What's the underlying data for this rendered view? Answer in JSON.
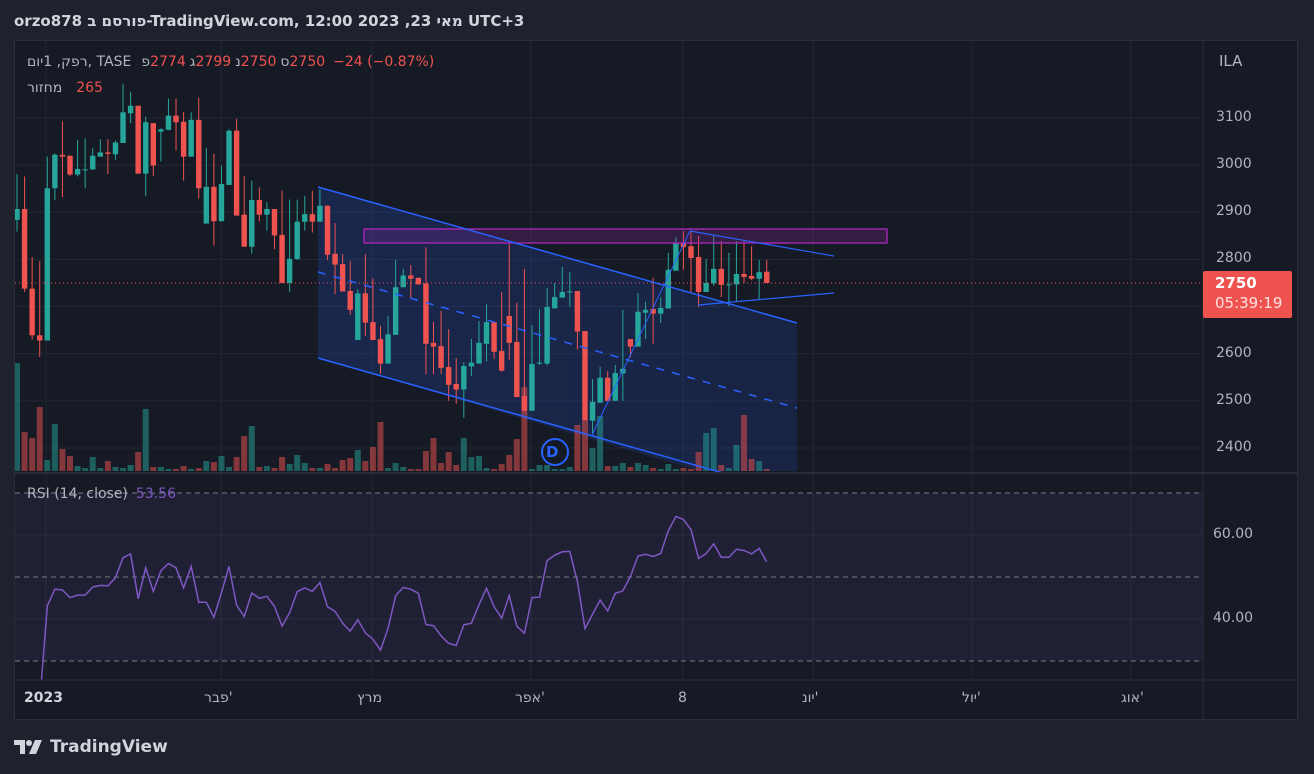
{
  "header": {
    "segments": [
      "orzo878 ",
      "פורסם ב",
      "-TradingView.com, 12:00 2023 ",
      ",23 ",
      "מאי",
      " UTC+3"
    ]
  },
  "legend": {
    "symbol": "רפק, 1יום, TASE",
    "open_label": "פ",
    "open": "2774",
    "high_label": "ג",
    "high": "2799",
    "low_label": "נ",
    "low": "2750",
    "close_label": "ס",
    "close": "2750",
    "change": "−24 (−0.87%)"
  },
  "volume_legend": {
    "label": "מחזור",
    "value": "265"
  },
  "rsi_legend": {
    "label": "RSI (14, close)",
    "value": "53.56"
  },
  "price_axis": {
    "currency": "ILA",
    "ticks": [
      "3100",
      "3000",
      "2900",
      "2800",
      "2600",
      "2500",
      "2400"
    ],
    "current_price": "2750",
    "countdown": "05:39:19"
  },
  "rsi_axis": {
    "ticks": [
      "60.00",
      "40.00"
    ]
  },
  "time_axis": {
    "ticks": [
      "2023",
      "פבר'",
      "מרץ",
      "אפר'",
      "8",
      "יונ'",
      "יול'",
      "אוג'"
    ]
  },
  "marker": {
    "label": "D"
  },
  "brand": {
    "name": "TradingView"
  },
  "colors": {
    "up": "#26a69a",
    "down": "#ef5350",
    "rsi": "#7e57c2",
    "drawing": "#2962ff",
    "zone": "#9c27b0"
  },
  "chart_data": {
    "type": "candlestick",
    "title": "רפק, 1יום, TASE",
    "ylabel": "ILA",
    "ylim": [
      2360,
      3190
    ],
    "y_ticks": [
      2400,
      2500,
      2600,
      2700,
      2800,
      2900,
      3000,
      3100
    ],
    "x_ticks": [
      "2023",
      "פבר'",
      "מרץ",
      "אפר'",
      "8",
      "יונ'",
      "יול'",
      "אוג'"
    ],
    "ohlc_fields": [
      "open",
      "high",
      "low",
      "close"
    ],
    "ohlc": [
      [
        2884,
        2981,
        2859,
        2907
      ],
      [
        2907,
        2976,
        2731,
        2738
      ],
      [
        2738,
        2805,
        2630,
        2639
      ],
      [
        2639,
        2796,
        2593,
        2628
      ],
      [
        2628,
        3018,
        2628,
        2951
      ],
      [
        2951,
        3025,
        2926,
        3022
      ],
      [
        3022,
        3093,
        2932,
        3018
      ],
      [
        3020,
        3020,
        2977,
        2980
      ],
      [
        2980,
        3054,
        2976,
        2992
      ],
      [
        2991,
        3057,
        2951,
        2991
      ],
      [
        2991,
        3036,
        2990,
        3020
      ],
      [
        3018,
        3055,
        3018,
        3027
      ],
      [
        3027,
        3055,
        2981,
        3024
      ],
      [
        3023,
        3052,
        3011,
        3048
      ],
      [
        3047,
        3173,
        3047,
        3112
      ],
      [
        3110,
        3156,
        3089,
        3126
      ],
      [
        3126,
        3126,
        2982,
        2982
      ],
      [
        2982,
        3103,
        2934,
        3091
      ],
      [
        3089,
        3089,
        2977,
        2999
      ],
      [
        3071,
        3078,
        3008,
        3076
      ],
      [
        3075,
        3141,
        3074,
        3105
      ],
      [
        3105,
        3141,
        3031,
        3091
      ],
      [
        3092,
        3113,
        2967,
        3018
      ],
      [
        3018,
        3112,
        3018,
        3096
      ],
      [
        3096,
        3143,
        2929,
        2951
      ],
      [
        2876,
        3036,
        2876,
        2954
      ],
      [
        2954,
        3024,
        2830,
        2881
      ],
      [
        2881,
        2999,
        2881,
        2960
      ],
      [
        2958,
        3076,
        2958,
        3073
      ],
      [
        3073,
        3098,
        2893,
        2893
      ],
      [
        2895,
        2977,
        2827,
        2827
      ],
      [
        2827,
        2967,
        2812,
        2926
      ],
      [
        2926,
        2953,
        2881,
        2895
      ],
      [
        2895,
        2922,
        2861,
        2907
      ],
      [
        2907,
        2907,
        2822,
        2851
      ],
      [
        2852,
        2946,
        2750,
        2750
      ],
      [
        2750,
        2927,
        2731,
        2801
      ],
      [
        2801,
        2927,
        2799,
        2880
      ],
      [
        2880,
        2935,
        2861,
        2896
      ],
      [
        2896,
        2946,
        2857,
        2880
      ],
      [
        2880,
        2948,
        2880,
        2914
      ],
      [
        2914,
        2914,
        2799,
        2810
      ],
      [
        2812,
        2877,
        2726,
        2789
      ],
      [
        2790,
        2811,
        2732,
        2732
      ],
      [
        2733,
        2797,
        2682,
        2693
      ],
      [
        2629,
        2737,
        2629,
        2728
      ],
      [
        2728,
        2811,
        2638,
        2666
      ],
      [
        2667,
        2760,
        2629,
        2629
      ],
      [
        2631,
        2659,
        2557,
        2579
      ],
      [
        2579,
        2680,
        2579,
        2641
      ],
      [
        2640,
        2799,
        2640,
        2741
      ],
      [
        2741,
        2780,
        2741,
        2766
      ],
      [
        2766,
        2788,
        2719,
        2759
      ],
      [
        2761,
        2761,
        2747,
        2747
      ],
      [
        2749,
        2826,
        2557,
        2621
      ],
      [
        2623,
        2667,
        2557,
        2615
      ],
      [
        2616,
        2691,
        2557,
        2570
      ],
      [
        2572,
        2652,
        2500,
        2534
      ],
      [
        2536,
        2591,
        2494,
        2524
      ],
      [
        2524,
        2582,
        2464,
        2574
      ],
      [
        2573,
        2631,
        2553,
        2581
      ],
      [
        2579,
        2669,
        2579,
        2623
      ],
      [
        2621,
        2705,
        2583,
        2667
      ],
      [
        2667,
        2667,
        2589,
        2604
      ],
      [
        2606,
        2731,
        2562,
        2564
      ],
      [
        2680,
        2837,
        2587,
        2623
      ],
      [
        2625,
        2708,
        2508,
        2508
      ],
      [
        2510,
        2780,
        2479,
        2479
      ],
      [
        2479,
        2661,
        2479,
        2578
      ],
      [
        2579,
        2695,
        2576,
        2581
      ],
      [
        2579,
        2739,
        2575,
        2699
      ],
      [
        2696,
        2750,
        2696,
        2720
      ],
      [
        2719,
        2784,
        2719,
        2731
      ],
      [
        2731,
        2773,
        2700,
        2732
      ],
      [
        2733,
        2733,
        2609,
        2647
      ],
      [
        2648,
        2648,
        2458,
        2458
      ],
      [
        2458,
        2546,
        2428,
        2498
      ],
      [
        2496,
        2572,
        2496,
        2549
      ],
      [
        2549,
        2563,
        2500,
        2500
      ],
      [
        2500,
        2576,
        2500,
        2559
      ],
      [
        2558,
        2693,
        2500,
        2568
      ],
      [
        2631,
        2631,
        2592,
        2615
      ],
      [
        2615,
        2729,
        2615,
        2689
      ],
      [
        2687,
        2710,
        2631,
        2693
      ],
      [
        2695,
        2761,
        2621,
        2685
      ],
      [
        2685,
        2720,
        2665,
        2697
      ],
      [
        2696,
        2814,
        2696,
        2778
      ],
      [
        2776,
        2848,
        2776,
        2835
      ],
      [
        2835,
        2860,
        2778,
        2826
      ],
      [
        2828,
        2860,
        2731,
        2803
      ],
      [
        2805,
        2850,
        2699,
        2731
      ],
      [
        2731,
        2801,
        2731,
        2750
      ],
      [
        2749,
        2850,
        2744,
        2780
      ],
      [
        2780,
        2839,
        2720,
        2746
      ],
      [
        2747,
        2814,
        2701,
        2747
      ],
      [
        2747,
        2839,
        2712,
        2769
      ],
      [
        2769,
        2841,
        2750,
        2763
      ],
      [
        2765,
        2828,
        2756,
        2759
      ],
      [
        2759,
        2799,
        2714,
        2773
      ],
      [
        2774,
        2799,
        2750,
        2750
      ]
    ],
    "volume_relative": [
      108,
      39,
      33,
      64,
      11,
      47,
      22,
      15,
      5,
      3,
      14,
      3,
      10,
      4,
      3,
      6,
      19,
      62,
      4,
      4,
      2,
      2,
      5,
      2,
      3,
      10,
      9,
      15,
      4,
      14,
      35,
      45,
      4,
      5,
      3,
      14,
      7,
      16,
      8,
      3,
      3,
      7,
      3,
      11,
      13,
      21,
      10,
      24,
      49,
      3,
      8,
      4,
      2,
      2,
      20,
      33,
      8,
      19,
      6,
      33,
      14,
      15,
      3,
      2,
      7,
      16,
      32,
      84,
      2,
      6,
      6,
      2,
      2,
      4,
      46,
      50,
      23,
      55,
      5,
      5,
      8,
      4,
      8,
      6,
      3,
      2,
      7,
      2,
      3,
      2,
      19,
      38,
      43,
      6,
      3,
      26,
      56,
      12,
      10,
      2
    ],
    "rsi": {
      "name": "RSI (14, close)",
      "start_bar": 5,
      "ylim": [
        25,
        75
      ],
      "levels": [
        70,
        50,
        30
      ],
      "values": [
        43.1,
        47.1,
        46.9,
        45.1,
        45.7,
        45.7,
        47.6,
        48.0,
        47.9,
        49.8,
        54.6,
        55.5,
        44.8,
        52.2,
        46.6,
        51.5,
        53.2,
        52.2,
        47.4,
        52.5,
        44.0,
        44.0,
        40.4,
        46.3,
        52.5,
        43.3,
        40.6,
        46.2,
        44.9,
        45.4,
        43.0,
        38.3,
        41.5,
        46.5,
        47.4,
        46.6,
        48.7,
        42.9,
        41.8,
        39.0,
        37.1,
        39.8,
        36.7,
        35.2,
        32.6,
        37.8,
        45.6,
        47.5,
        47.1,
        46.1,
        38.7,
        38.4,
        36.0,
        34.2,
        33.7,
        38.6,
        39.0,
        43.4,
        47.3,
        42.9,
        40.2,
        45.6,
        38.3,
        36.6,
        45.1,
        45.2,
        53.9,
        55.2,
        56.0,
        56.1,
        48.9,
        37.7,
        41.1,
        44.5,
        41.9,
        46.1,
        46.7,
        50.1,
        55.0,
        55.4,
        54.9,
        55.6,
        61.0,
        64.4,
        63.7,
        61.3,
        54.4,
        55.6,
        57.9,
        54.7,
        54.7,
        56.6,
        56.3,
        55.5,
        56.8,
        53.56
      ]
    },
    "last_price": 2750,
    "grid": true
  }
}
